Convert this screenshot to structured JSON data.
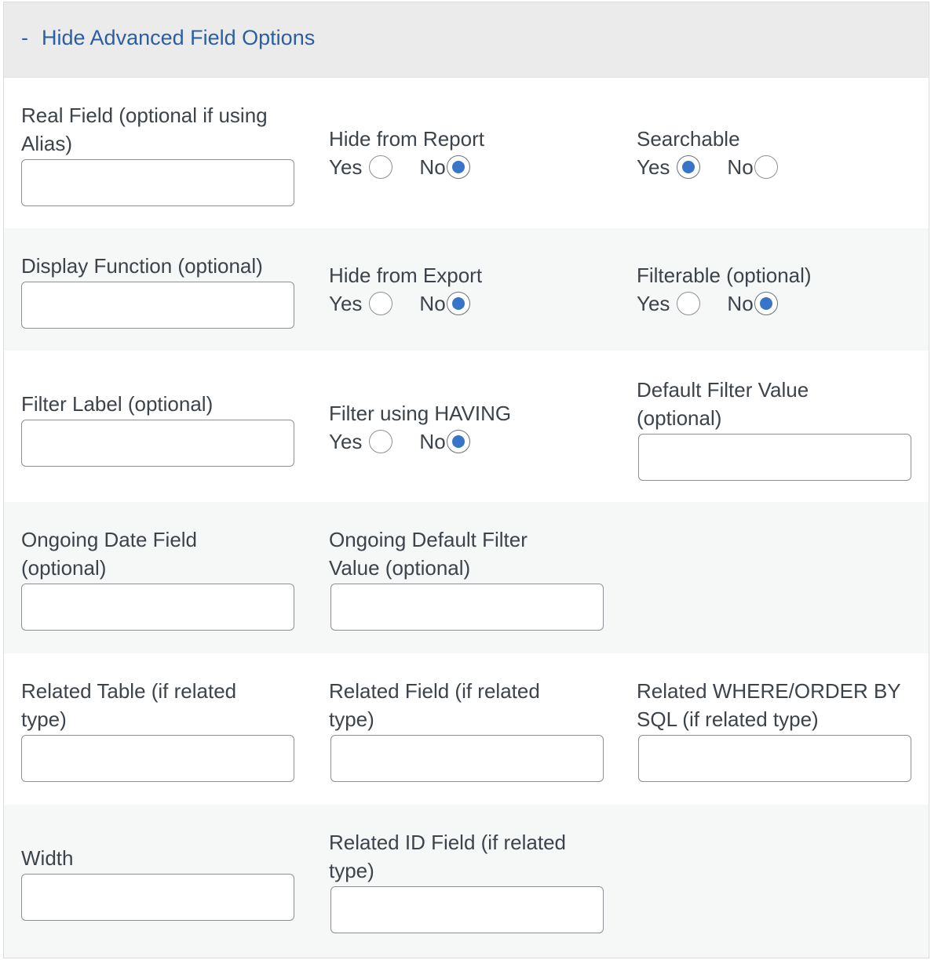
{
  "header": {
    "toggle_symbol": "-",
    "toggle_label": "Hide Advanced Field Options"
  },
  "real_field": {
    "label_line1": "Real Field (optional if using",
    "label_line2": "Alias)",
    "value": ""
  },
  "hide_from_report": {
    "label": "Hide from Report",
    "yes_label": "Yes",
    "no_label": "No",
    "selected": "No"
  },
  "searchable": {
    "label": "Searchable",
    "yes_label": "Yes",
    "no_label": "No",
    "selected": "Yes"
  },
  "display_function": {
    "label": "Display Function (optional)",
    "value": ""
  },
  "hide_from_export": {
    "label": "Hide from Export",
    "yes_label": "Yes",
    "no_label": "No",
    "selected": "No"
  },
  "filterable": {
    "label": "Filterable (optional)",
    "yes_label": "Yes",
    "no_label": "No",
    "selected": "No"
  },
  "filter_label": {
    "label": "Filter Label (optional)",
    "value": ""
  },
  "filter_using_having": {
    "label": "Filter using HAVING",
    "yes_label": "Yes",
    "no_label": "No",
    "selected": "No"
  },
  "default_filter_value": {
    "label_line1": "Default Filter Value",
    "label_line2": "(optional)",
    "value": ""
  },
  "ongoing_date_field": {
    "label_line1": "Ongoing Date Field",
    "label_line2": "(optional)",
    "value": ""
  },
  "ongoing_default_filter_value": {
    "label_line1": "Ongoing Default Filter",
    "label_line2": "Value (optional)",
    "value": ""
  },
  "related_table": {
    "label_line1": "Related Table (if related",
    "label_line2": "type)",
    "value": ""
  },
  "related_field": {
    "label_line1": "Related Field (if related",
    "label_line2": "type)",
    "value": ""
  },
  "related_where": {
    "label_line1": "Related WHERE/ORDER BY",
    "label_line2": "SQL (if related type)",
    "value": ""
  },
  "width": {
    "label": "Width",
    "value": ""
  },
  "related_id_field": {
    "label_line1": "Related ID Field (if related",
    "label_line2": "type)",
    "value": ""
  },
  "colors": {
    "link": "#2b5fa2",
    "radio_checked": "#3874c8",
    "header_bg": "#ebebeb",
    "alt_row_bg": "#f6f7f7"
  }
}
